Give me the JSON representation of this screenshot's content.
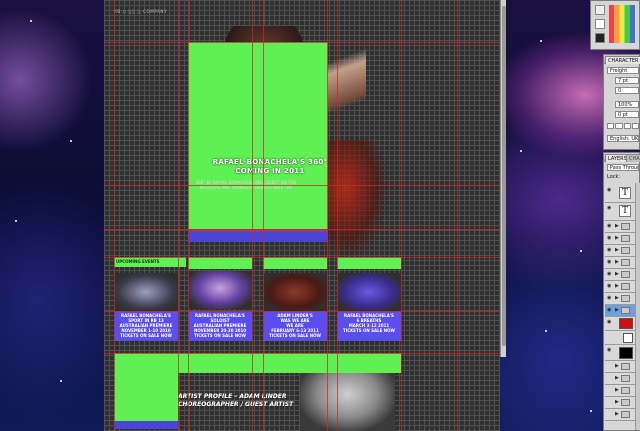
{
  "document": {
    "header_label": "RB ∕∕ ░░ ░ COMPANY",
    "hero": {
      "title_line1": "RAFAEL BONACHELA'S 360°",
      "title_line2": "COMING IN 2011",
      "sub_line1": "360° BY RAFAEL BONACHELA WILL DEBUT ON THE",
      "sub_line2": "NICHOLAS AND YOUNGEST DANCER DATE TBA"
    },
    "events_heading": "UPCOMING EVENTS",
    "events": [
      {
        "line1": "RAFAEL BONACHELA'S",
        "line2": "SPORT IN RB 13",
        "line3": "AUSTRALIAN PREMIERE",
        "line4": "NOVEMBER 1-10 2010",
        "line5": "TICKETS ON SALE NOW"
      },
      {
        "line1": "RAFAEL BONACHELA'S",
        "line2": "SOLOIST",
        "line3": "AUSTRALIAN PREMIERE",
        "line4": "NOVEMBER 20-30 2010",
        "line5": "TICKETS ON SALE NOW"
      },
      {
        "line1": "ADAM LINDER'S",
        "line2": "WAS WE ARE",
        "line3": "WE ARE",
        "line4": "FEBRUARY 6-13 2011",
        "line5": "TICKETS ON SALE NOW"
      },
      {
        "line1": "RAFAEL BONACHELA'S",
        "line2": "6 BREATHS",
        "line3": "",
        "line4": "MARCH 3-12 2011",
        "line5": "TICKETS ON SALE NOW"
      }
    ],
    "profile_line1": "ARTIST PROFILE – ADAM LINDER",
    "profile_line2": "CHOREOGRAPHER / GUEST ARTIST"
  },
  "panels": {
    "character_tab": "CHARACTER",
    "font_name": "Freight",
    "font_size": "7 pt",
    "kerning": "0",
    "scale": "100%",
    "baseline": "0 pt",
    "language": "English: UK",
    "layers_tab": "LAYERS",
    "channels_tab": "CHA",
    "blend_mode": "Pass Through",
    "lock_label": "Lock:",
    "text_layer_glyph": "T"
  },
  "colors": {
    "slice_green": "#5ff054",
    "guide_red": "#c82828",
    "slice_blue": "#4d45d8",
    "canvas_dark": "#2f2f2f",
    "swatch_red": "#cc1111",
    "swatch_black": "#000000"
  }
}
